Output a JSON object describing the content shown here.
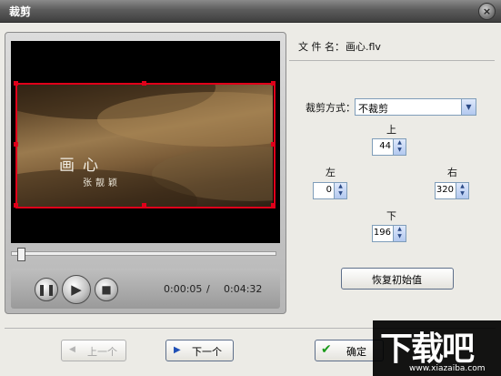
{
  "window": {
    "title": "裁剪",
    "close_symbol": "×"
  },
  "file": {
    "label": "文 件 名：",
    "name": "画心.flv"
  },
  "video": {
    "title_text": "画心",
    "subtitle_text": "张靓颖"
  },
  "player": {
    "current_time": "0:00:05",
    "separator": "/",
    "total_time": "0:04:32",
    "progress_fraction": 0.02
  },
  "crop": {
    "mode_label": "裁剪方式：",
    "mode_value": "不裁剪",
    "top_label": "上",
    "top_value": "44",
    "left_label": "左",
    "left_value": "0",
    "right_label": "右",
    "right_value": "320",
    "bottom_label": "下",
    "bottom_value": "196",
    "reset_label": "恢复初始值"
  },
  "nav": {
    "prev_label": "上一个",
    "next_label": "下一个",
    "ok_label": "确定"
  },
  "watermark": {
    "brand": "下载吧",
    "url": "www.xiazaiba.com"
  },
  "colors": {
    "crop_border": "#e0001a",
    "title_bar": "#4a4a4a",
    "window_bg": "#ecebe6"
  }
}
